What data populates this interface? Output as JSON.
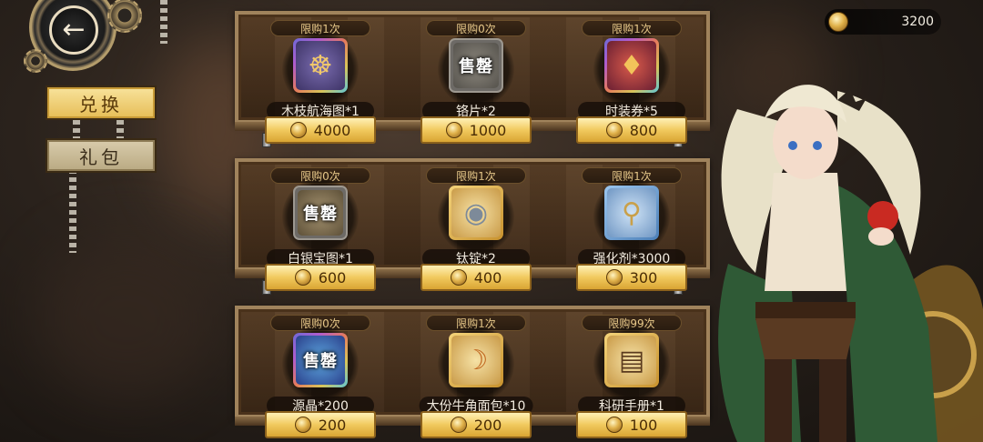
{
  "nav": {
    "back_icon": "arrow-left-icon",
    "side_menu": [
      {
        "label": "兑换",
        "active": true
      },
      {
        "label": "礼包",
        "active": false
      }
    ]
  },
  "currency": {
    "icon": "coin-icon",
    "amount": "3200"
  },
  "shelves": [
    {
      "items": [
        {
          "limit": "限购1次",
          "name": "木枝航海图*1",
          "price": "4000",
          "icon": "ship-map-icon",
          "sold_out": false,
          "rarity": "rainbow"
        },
        {
          "limit": "限购0次",
          "name": "铬片*2",
          "price": "1000",
          "icon": "chrome-sheet-icon",
          "sold_out": true,
          "sold_label": "售罄",
          "rarity": "gray"
        },
        {
          "limit": "限购1次",
          "name": "时装券*5",
          "price": "800",
          "icon": "costume-ticket-icon",
          "sold_out": false,
          "rarity": "rainbow"
        }
      ]
    },
    {
      "items": [
        {
          "limit": "限购0次",
          "name": "白银宝图*1",
          "price": "600",
          "icon": "treasure-map-icon",
          "sold_out": true,
          "sold_label": "售罄",
          "rarity": "gray"
        },
        {
          "limit": "限购1次",
          "name": "钛锭*2",
          "price": "400",
          "icon": "titanium-ingot-icon",
          "sold_out": false,
          "rarity": "gold"
        },
        {
          "limit": "限购1次",
          "name": "强化剂*3000",
          "price": "300",
          "icon": "enhancer-vial-icon",
          "sold_out": false,
          "rarity": "blue"
        }
      ]
    },
    {
      "items": [
        {
          "limit": "限购0次",
          "name": "源晶*200",
          "price": "200",
          "icon": "source-crystal-icon",
          "sold_out": true,
          "sold_label": "售罄",
          "rarity": "rainbow"
        },
        {
          "limit": "限购1次",
          "name": "大份牛角面包*10",
          "price": "200",
          "icon": "croissant-icon",
          "sold_out": false,
          "rarity": "gold"
        },
        {
          "limit": "限购99次",
          "name": "科研手册*1",
          "price": "100",
          "icon": "research-manual-icon",
          "sold_out": false,
          "rarity": "gold"
        }
      ]
    }
  ],
  "colors": {
    "price_button": "#f1c95e",
    "active_tab": "#e6bd56",
    "shelf_wood": "#5c4128",
    "limit_text": "#e8c98a"
  }
}
